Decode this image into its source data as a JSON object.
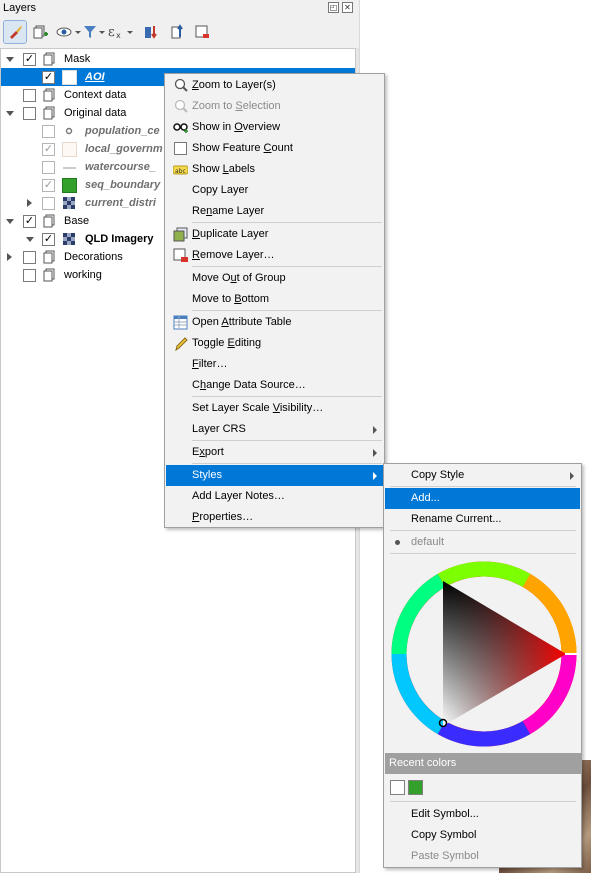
{
  "panel": {
    "title": "Layers"
  },
  "layers": [
    {
      "label": "Mask",
      "checked": "✓"
    },
    {
      "label": "AOI",
      "checked": "✓"
    },
    {
      "label": "Context data",
      "checked": ""
    },
    {
      "label": "Original data",
      "checked": ""
    },
    {
      "label": "population_ce",
      "checked": ""
    },
    {
      "label": "local_governm",
      "checked": "✓"
    },
    {
      "label": "watercourse_",
      "checked": ""
    },
    {
      "label": "seq_boundary",
      "checked": "✓"
    },
    {
      "label": "current_distri",
      "checked": ""
    },
    {
      "label": "Base",
      "checked": "✓"
    },
    {
      "label": "QLD Imagery",
      "checked": "✓"
    },
    {
      "label": "Decorations",
      "checked": ""
    },
    {
      "label": "working",
      "checked": ""
    }
  ],
  "context_menu": {
    "items": [
      {
        "pre": "",
        "u": "Z",
        "post": "oom to Layer(s)"
      },
      {
        "pre": "Zoom to ",
        "u": "S",
        "post": "election"
      },
      {
        "pre": "Show in ",
        "u": "O",
        "post": "verview"
      },
      {
        "pre": "Show Feature ",
        "u": "C",
        "post": "ount"
      },
      {
        "pre": "Show ",
        "u": "L",
        "post": "abels"
      },
      {
        "pre": "Copy Layer",
        "u": "",
        "post": ""
      },
      {
        "pre": "Re",
        "u": "n",
        "post": "ame Layer"
      },
      {
        "pre": "",
        "u": "D",
        "post": "uplicate Layer"
      },
      {
        "pre": "",
        "u": "R",
        "post": "emove Layer…"
      },
      {
        "pre": "Move O",
        "u": "u",
        "post": "t of Group"
      },
      {
        "pre": "Move to ",
        "u": "B",
        "post": "ottom"
      },
      {
        "pre": "Open ",
        "u": "A",
        "post": "ttribute Table"
      },
      {
        "pre": "Toggle ",
        "u": "E",
        "post": "diting"
      },
      {
        "pre": "",
        "u": "F",
        "post": "ilter…"
      },
      {
        "pre": "C",
        "u": "h",
        "post": "ange Data Source…"
      },
      {
        "pre": "Set Layer Scale ",
        "u": "V",
        "post": "isibility…"
      },
      {
        "pre": "Layer CRS",
        "u": "",
        "post": ""
      },
      {
        "pre": "E",
        "u": "x",
        "post": "port"
      },
      {
        "pre": "Styles",
        "u": "",
        "post": ""
      },
      {
        "pre": "Add Layer Notes…",
        "u": "",
        "post": ""
      },
      {
        "pre": "",
        "u": "P",
        "post": "roperties…"
      }
    ]
  },
  "styles_menu": {
    "copy_style": "Copy Style",
    "add": "Add...",
    "rename_current": "Rename Current...",
    "default": "default",
    "recent_colors": "Recent colors",
    "edit_symbol": "Edit Symbol...",
    "copy_symbol": "Copy Symbol",
    "paste_symbol": "Paste Symbol",
    "recent_swatches": [
      "#ffffff",
      "#33a02c"
    ],
    "selected_hue": "#ff0000"
  },
  "colors": {
    "highlight": "#0078d7",
    "seq_boundary_fill": "#33a02c"
  }
}
